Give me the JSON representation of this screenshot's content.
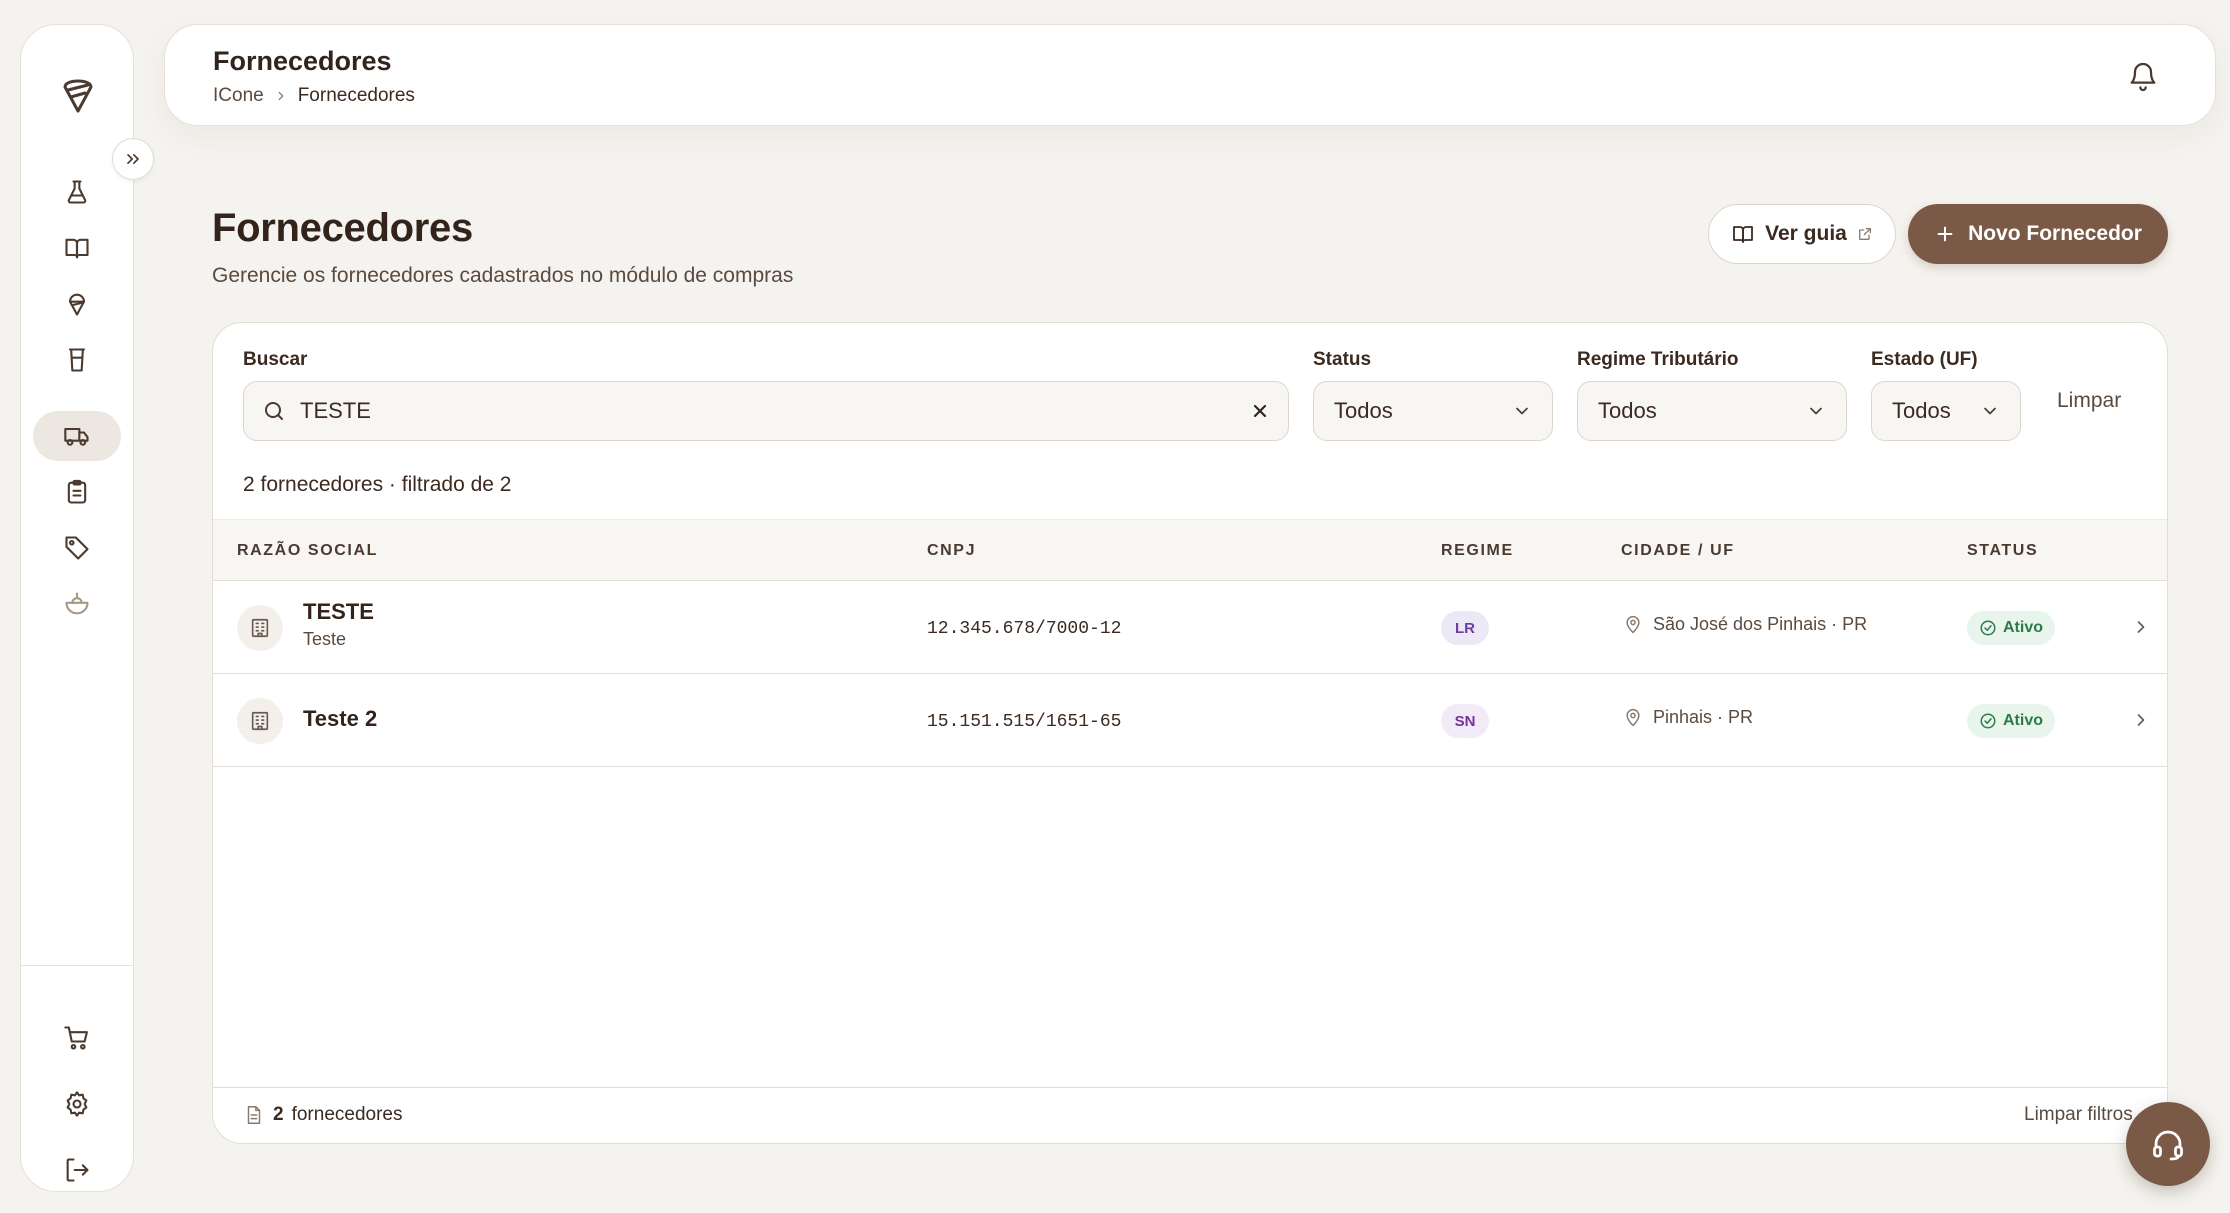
{
  "colors": {
    "accent": "#7a5a47",
    "background": "#f5f3ef",
    "text": "#33241b",
    "status_active_bg": "#e8f5ec",
    "status_active_text": "#2e7a47",
    "lr_badge_bg": "#ede8f6",
    "lr_badge_text": "#6b3fa0",
    "sn_badge_bg": "#f3eaf8",
    "sn_badge_text": "#7a2fa0"
  },
  "sidebar": {
    "logo_icon": "ice-cream-cone-logo",
    "items": [
      {
        "id": "lab",
        "icon": "flask-icon"
      },
      {
        "id": "book",
        "icon": "book-icon"
      },
      {
        "id": "cone",
        "icon": "ice-cream-cone-icon"
      },
      {
        "id": "cup",
        "icon": "cup-icon"
      },
      {
        "id": "fornecedores",
        "icon": "truck-icon",
        "active": true
      },
      {
        "id": "clipboard",
        "icon": "clipboard-icon"
      },
      {
        "id": "tags",
        "icon": "tag-icon"
      },
      {
        "id": "bowl",
        "icon": "bowl-icon"
      }
    ],
    "bottom_items": [
      {
        "id": "cart",
        "icon": "cart-icon"
      },
      {
        "id": "settings",
        "icon": "gear-icon"
      },
      {
        "id": "logout",
        "icon": "logout-icon"
      }
    ]
  },
  "header": {
    "title": "Fornecedores",
    "breadcrumb": [
      "ICone",
      "Fornecedores"
    ]
  },
  "page": {
    "title": "Fornecedores",
    "subtitle": "Gerencie os fornecedores cadastrados no módulo de compras",
    "guide_button": "Ver guia",
    "new_button": "Novo Fornecedor"
  },
  "filters": {
    "search_label": "Buscar",
    "search_value": "TESTE",
    "status_label": "Status",
    "status_value": "Todos",
    "regime_label": "Regime Tributário",
    "regime_value": "Todos",
    "estado_label": "Estado (UF)",
    "estado_value": "Todos",
    "clear_label": "Limpar"
  },
  "results_summary": "2 fornecedores · filtrado de 2",
  "table": {
    "columns": [
      "RAZÃO SOCIAL",
      "CNPJ",
      "REGIME",
      "CIDADE / UF",
      "STATUS"
    ],
    "rows": [
      {
        "name": "TESTE",
        "subtitle": "Teste",
        "cnpj": "12.345.678/7000-12",
        "regime": "LR",
        "city": "São José dos Pinhais · PR",
        "status": "Ativo"
      },
      {
        "name": "Teste 2",
        "subtitle": "",
        "cnpj": "15.151.515/1651-65",
        "regime": "SN",
        "city": "Pinhais · PR",
        "status": "Ativo"
      }
    ]
  },
  "footer": {
    "count_number": "2",
    "count_label": "fornecedores",
    "clear_filters": "Limpar filtros"
  }
}
